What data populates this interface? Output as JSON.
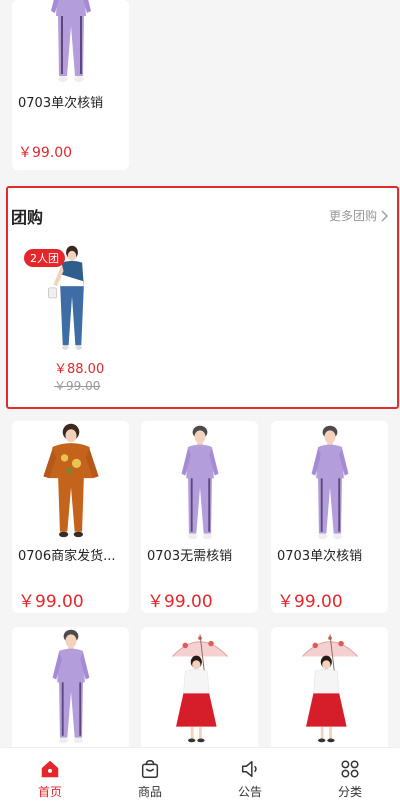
{
  "products_top": [
    {
      "name": "0703单次核销",
      "price": "￥99.00",
      "image": "purple-outfit"
    }
  ],
  "group_buy": {
    "title": "团购",
    "more_label": "更多团购",
    "item": {
      "badge": "2人团",
      "price": "￥88.00",
      "original_price": "￥99.00",
      "image": "blue-white-outfit"
    }
  },
  "products_row2": [
    {
      "name": "0706商家发货...",
      "price": "￥99.00",
      "image": "orange-outfit"
    },
    {
      "name": "0703无需核销",
      "price": "￥99.00",
      "image": "purple-outfit"
    },
    {
      "name": "0703单次核销",
      "price": "￥99.00",
      "image": "purple-outfit"
    }
  ],
  "products_row3": [
    {
      "image": "purple-outfit"
    },
    {
      "image": "umbrella-dress"
    },
    {
      "image": "umbrella-dress"
    }
  ],
  "tabbar": [
    {
      "label": "首页",
      "icon": "home-icon",
      "active": true
    },
    {
      "label": "商品",
      "icon": "bag-icon",
      "active": false
    },
    {
      "label": "公告",
      "icon": "speaker-icon",
      "active": false
    },
    {
      "label": "分类",
      "icon": "grid-icon",
      "active": false
    }
  ],
  "colors": {
    "accent": "#e5262b",
    "highlight_border": "#e32b2b",
    "muted": "#999999"
  }
}
